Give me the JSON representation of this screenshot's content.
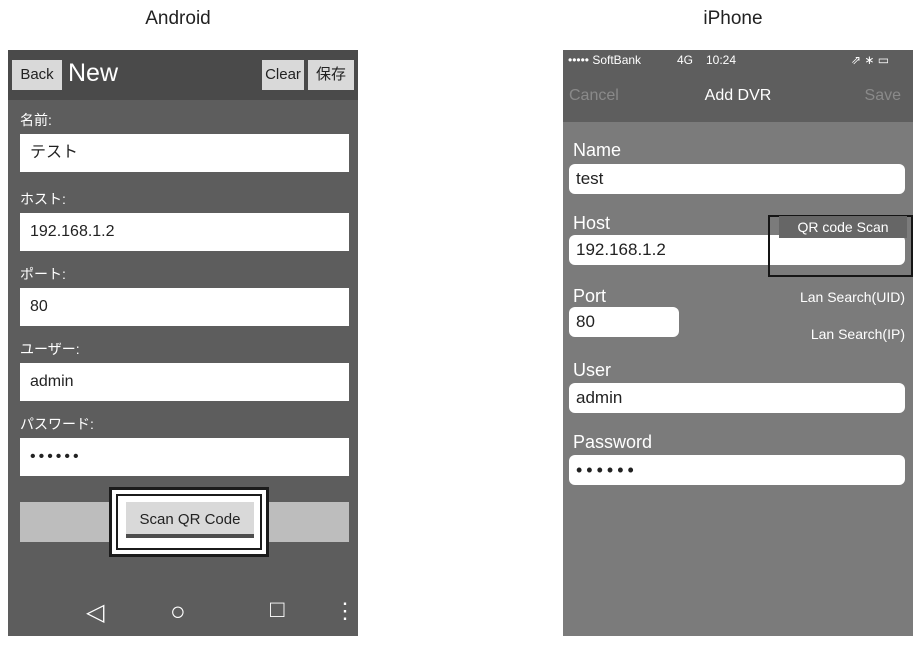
{
  "captions": {
    "android": "Android",
    "iphone": "iPhone"
  },
  "android": {
    "back_label": "Back",
    "title": "New",
    "clear_label": "Clear",
    "save_label": "保存",
    "fields": {
      "name": {
        "label": "名前:",
        "value": "テスト"
      },
      "host": {
        "label": "ホスト:",
        "value": "192.168.1.2"
      },
      "port": {
        "label": "ポート:",
        "value": "80"
      },
      "user": {
        "label": "ユーザー:",
        "value": "admin"
      },
      "password": {
        "label": "パスワード:",
        "value": "••••••"
      }
    },
    "scan_label": "Scan QR Code",
    "nav": {
      "back_glyph": "◁",
      "home_glyph": "○",
      "recents_glyph": "□",
      "menu_glyph": "⋮"
    }
  },
  "iphone": {
    "status": {
      "carrier": "••••• SoftBank",
      "network": "4G",
      "time": "10:24",
      "icons": "⇗ ∗ ▭"
    },
    "nav": {
      "cancel_label": "Cancel",
      "title": "Add DVR",
      "save_label": "Save"
    },
    "fields": {
      "name": {
        "label": "Name",
        "value": "test"
      },
      "host": {
        "label": "Host",
        "value": "192.168.1.2"
      },
      "port": {
        "label": "Port",
        "value": "80"
      },
      "user": {
        "label": "User",
        "value": "admin"
      },
      "password": {
        "label": "Password",
        "value": "••••••"
      }
    },
    "qr_scan_label": "QR code Scan",
    "lan_search_uid_label": "Lan Search(UID)",
    "lan_search_ip_label": "Lan Search(IP)"
  }
}
